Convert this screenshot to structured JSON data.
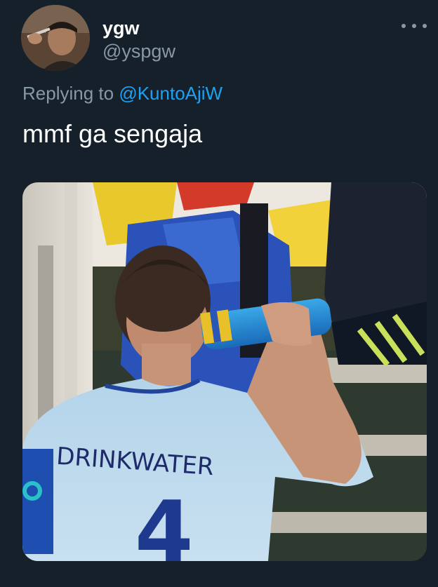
{
  "tweet": {
    "display_name": "ygw",
    "handle": "@yspgw",
    "reply_prefix": "Replying to",
    "reply_mention": "@KuntoAjiW",
    "text": "mmf ga sengaja",
    "menu_icon": "more-horizontal-icon"
  },
  "media": {
    "shirt_name": "DRINKWATER",
    "shirt_number": "4"
  },
  "colors": {
    "background": "#15202b",
    "secondary_text": "#8899a6",
    "link": "#1da1f2",
    "primary_text": "#ffffff"
  }
}
